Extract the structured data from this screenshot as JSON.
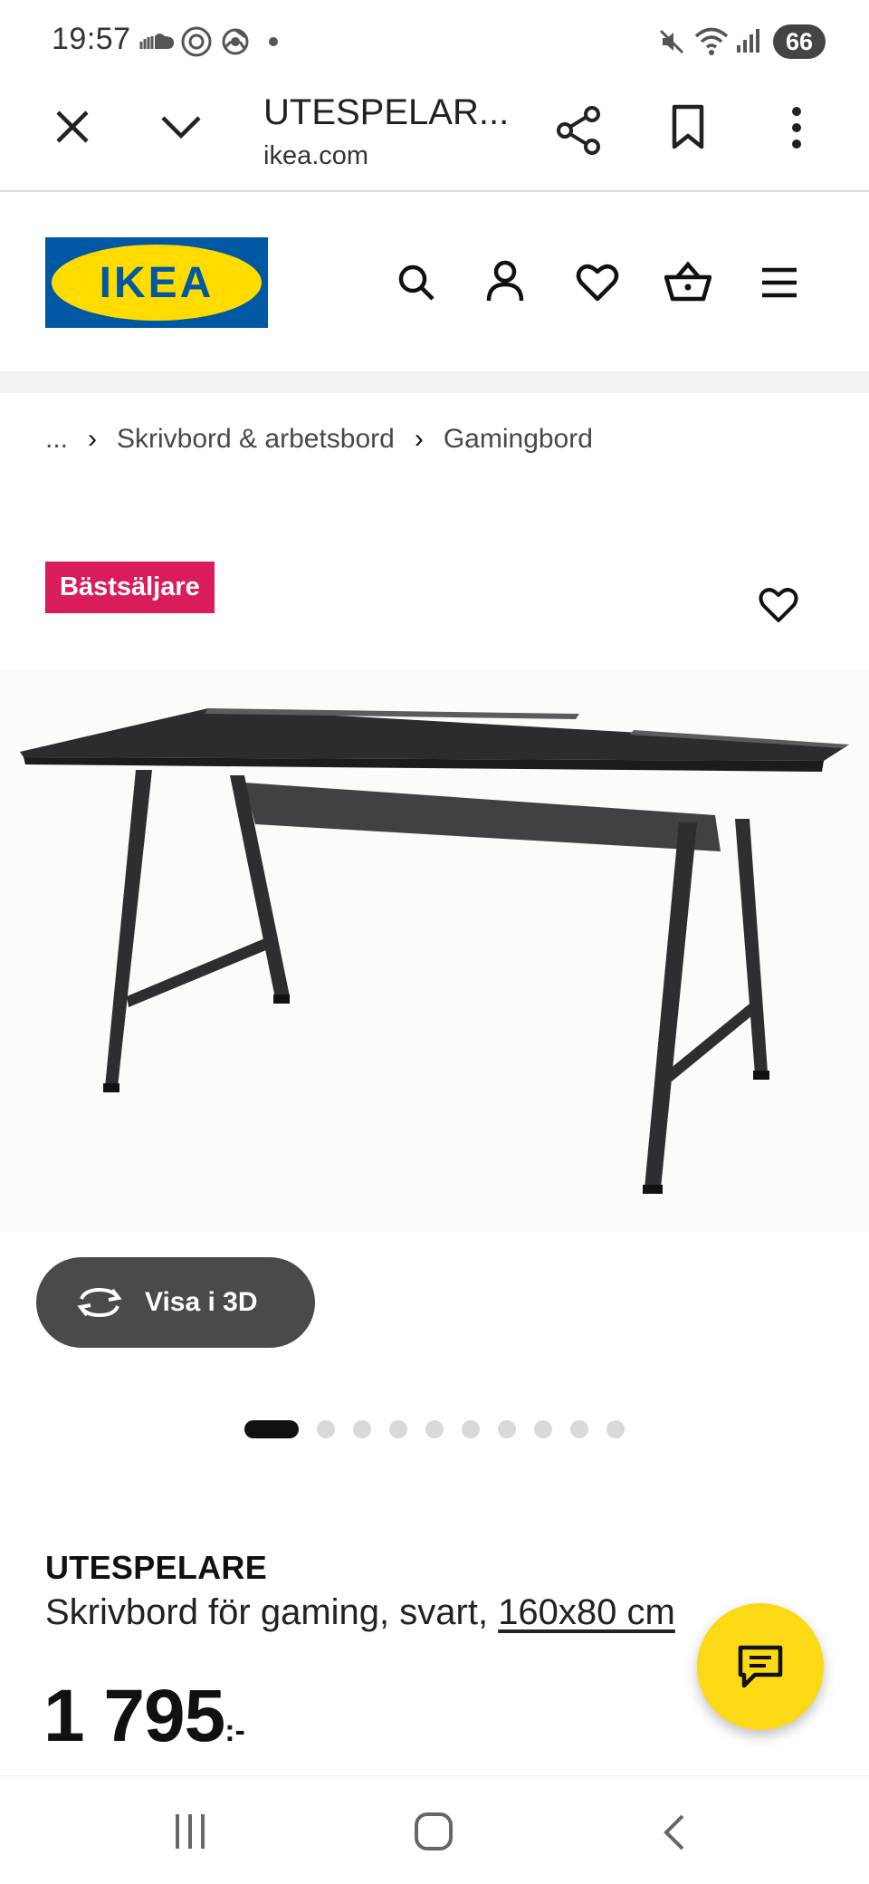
{
  "status_bar": {
    "time": "19:57",
    "battery": "66",
    "left_icons": [
      "soundcloud-icon",
      "threads-icon",
      "chrome-icon",
      "dot-icon"
    ],
    "right_icons": [
      "mute-icon",
      "wifi-icon",
      "signal-icon",
      "battery-icon"
    ]
  },
  "browser": {
    "title": "UTESPELAR...",
    "url": "ikea.com",
    "icons": [
      "close-icon",
      "chevron-down-icon",
      "share-icon",
      "bookmark-icon",
      "more-icon"
    ]
  },
  "header": {
    "logo_text": "IKEA",
    "logo_colors": {
      "blue": "#0058a3",
      "yellow": "#ffdb00"
    },
    "icons": [
      "search-icon",
      "account-icon",
      "favorites-icon",
      "cart-icon",
      "menu-icon"
    ]
  },
  "breadcrumb": {
    "items": [
      "...",
      "Skrivbord & arbetsbord",
      "Gamingbord"
    ]
  },
  "product": {
    "badge": "Bästsäljare",
    "badge_color": "#d91c5c",
    "view_3d_label": "Visa i 3D",
    "image_count": 10,
    "active_image": 1,
    "name": "UTESPELARE",
    "description": "Skrivbord för gaming, svart,",
    "size_link": "160x80 cm",
    "price": "1 795",
    "price_suffix": ":-"
  },
  "chat": {
    "icon": "chat-icon",
    "color": "#fbd914"
  },
  "nav_bar": {
    "icons": [
      "recents-icon",
      "home-icon",
      "back-icon"
    ]
  }
}
